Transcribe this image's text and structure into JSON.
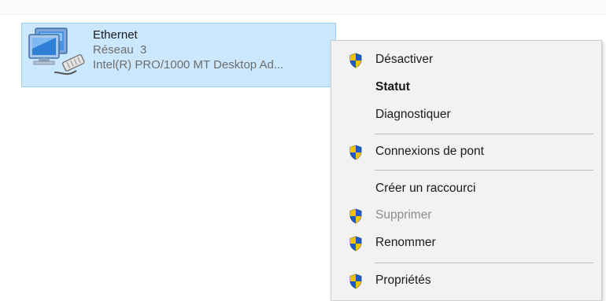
{
  "adapter": {
    "name": "Ethernet",
    "network": "Réseau  3",
    "device": "Intel(R) PRO/1000 MT Desktop Ad..."
  },
  "context_menu": {
    "items": [
      {
        "label": "Désactiver",
        "icon": "uac-shield-icon",
        "state": "normal"
      },
      {
        "label": "Statut",
        "icon": null,
        "state": "default-bold"
      },
      {
        "label": "Diagnostiquer",
        "icon": null,
        "state": "normal"
      },
      {
        "label": "Connexions de pont",
        "icon": "uac-shield-icon",
        "state": "normal"
      },
      {
        "label": "Créer un raccourci",
        "icon": null,
        "state": "normal"
      },
      {
        "label": "Supprimer",
        "icon": "uac-shield-icon",
        "state": "disabled"
      },
      {
        "label": "Renommer",
        "icon": "uac-shield-icon",
        "state": "normal"
      },
      {
        "label": "Propriétés",
        "icon": "uac-shield-icon",
        "state": "normal"
      }
    ]
  },
  "colors": {
    "selection_bg": "#cce8ff",
    "selection_border": "#99d1ff",
    "menu_bg": "#f2f2f2",
    "shield_blue": "#1e5bc6",
    "shield_yellow": "#f6c200"
  }
}
